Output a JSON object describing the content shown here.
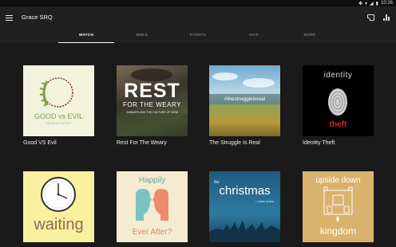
{
  "status": {
    "time": "10:26"
  },
  "app": {
    "title": "Grace SRQ"
  },
  "tabs": [
    {
      "label": "WATCH",
      "active": true
    },
    {
      "label": "BIBLE",
      "active": false
    },
    {
      "label": "EVENTS",
      "active": false
    },
    {
      "label": "GIVE",
      "active": false
    },
    {
      "label": "MORE",
      "active": false
    }
  ],
  "series": [
    {
      "title": "Good VS Evil",
      "art": {
        "line1": "GOOD vs EVIL",
        "line2": "spiritual warfare"
      }
    },
    {
      "title": "Rest For The Weary",
      "art": {
        "line1": "REST",
        "line2": "FOR THE WEARY",
        "line3": "SABBATH AND THE CULTURE OF NOW"
      }
    },
    {
      "title": "The Struggle Is Real",
      "art": {
        "line1": "#thestruggleisreal"
      }
    },
    {
      "title": "Identity Theft",
      "art": {
        "line1": "identity",
        "line2": "theft"
      }
    },
    {
      "title": "",
      "art": {
        "line1": "waiting"
      }
    },
    {
      "title": "",
      "art": {
        "line1": "Happily",
        "line2": "Ever After?"
      }
    },
    {
      "title": "",
      "art": {
        "line1": "the",
        "line2": "christmas",
        "line3": "i never knew"
      }
    },
    {
      "title": "",
      "art": {
        "line1": "upside down",
        "line2": "kingdom"
      }
    }
  ],
  "colors": {
    "appbar": "#202020",
    "background": "#1a1a1a",
    "good_evil_bg": "#f3f2dc",
    "good_evil_text": "#7aa047",
    "theft_red": "#e0231c",
    "waiting_bg": "#f8f09e",
    "waiting_text": "#8c6a5a",
    "happily_bg": "#f4ebd0",
    "christmas_bg": "#1f5b80",
    "upside_bg": "#d9b36e"
  }
}
